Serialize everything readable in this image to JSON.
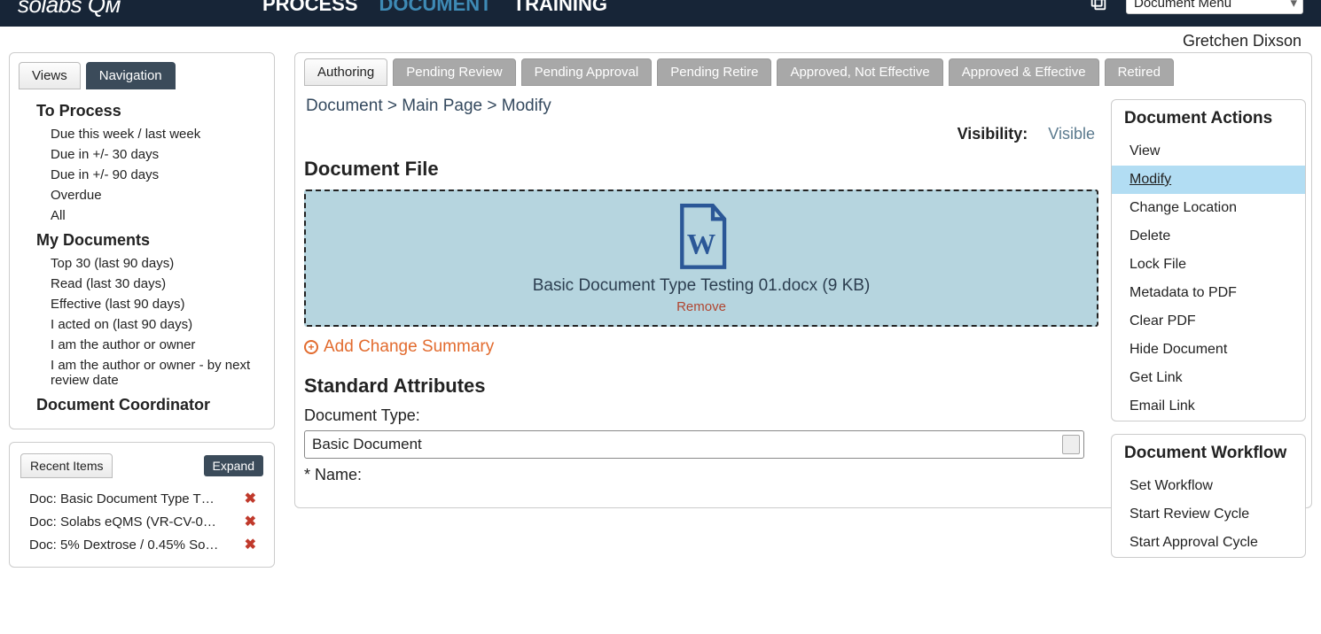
{
  "header": {
    "logo": "sᴏlabs Qᴍ",
    "nav": {
      "process": "PROCESS",
      "document": "DOCUMENT",
      "training": "TRAINING"
    },
    "menu_label": "Document Menu"
  },
  "user": "Gretchen Dixson",
  "sidebar": {
    "tabs": {
      "views": "Views",
      "navigation": "Navigation"
    },
    "to_process": {
      "heading": "To Process",
      "items": [
        "Due this week / last week",
        "Due in +/- 30 days",
        "Due in +/- 90 days",
        "Overdue",
        "All"
      ]
    },
    "my_docs": {
      "heading": "My Documents",
      "items": [
        "Top 30 (last 90 days)",
        "Read (last 30 days)",
        "Effective (last 90 days)",
        "I acted on (last 90 days)",
        "I am the author or owner",
        "I am the author or owner - by next review date"
      ]
    },
    "doc_coord": "Document Coordinator"
  },
  "recent": {
    "tab": "Recent Items",
    "expand": "Expand",
    "items": [
      "Doc: Basic Document Type T…",
      "Doc: Solabs eQMS (VR-CV-0…",
      "Doc: 5% Dextrose / 0.45% So…"
    ]
  },
  "main": {
    "tabs": [
      "Authoring",
      "Pending Review",
      "Pending Approval",
      "Pending Retire",
      "Approved, Not Effective",
      "Approved & Effective",
      "Retired"
    ],
    "breadcrumb": "Document > Main Page > Modify",
    "visibility": {
      "label": "Visibility:",
      "value": "Visible"
    },
    "file_section": {
      "heading": "Document File",
      "filename": "Basic Document Type Testing 01.docx (9 KB)",
      "remove": "Remove",
      "add_summary": "Add Change Summary"
    },
    "attrs": {
      "heading": "Standard Attributes",
      "doc_type_label": "Document Type:",
      "doc_type_value": "Basic Document",
      "name_label": "* Name:"
    }
  },
  "actions": {
    "doc_actions": {
      "heading": "Document Actions",
      "items": [
        "View",
        "Modify",
        "Change Location",
        "Delete",
        "Lock File",
        "Metadata to PDF",
        "Clear PDF",
        "Hide Document",
        "Get Link",
        "Email Link"
      ]
    },
    "workflow": {
      "heading": "Document Workflow",
      "items": [
        "Set Workflow",
        "Start Review Cycle",
        "Start Approval Cycle"
      ]
    }
  }
}
